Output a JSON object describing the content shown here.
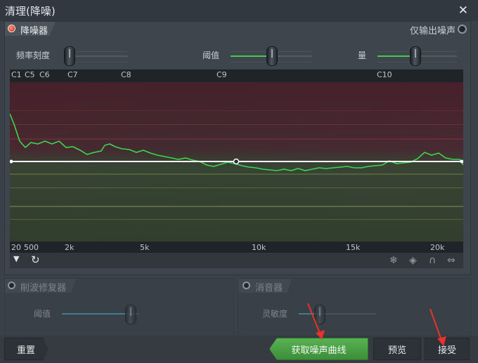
{
  "window": {
    "title": "清理(降噪)",
    "close_icon": "close-icon"
  },
  "denoiser": {
    "label": "降噪器",
    "enabled": true,
    "output_noise_only_label": "仅输出噪声",
    "output_noise_only": false,
    "controls": [
      {
        "label": "频率刻度",
        "level": 0.0
      },
      {
        "label": "阈值",
        "level": 0.5
      },
      {
        "label": "量",
        "level": 0.5
      }
    ]
  },
  "ruler": {
    "notes": [
      "C1",
      "C5",
      "C6",
      "C7",
      "C8",
      "C9",
      "C10"
    ]
  },
  "freq_axis": {
    "labels": [
      "20",
      "500",
      "2k",
      "5k",
      "10k",
      "15k",
      "20k"
    ]
  },
  "toolbar": {
    "left_icons": [
      "dropdown-arrow-icon",
      "reset-icon"
    ],
    "right_icons": [
      "snowflake-icon",
      "tag-icon",
      "magnet-icon",
      "arrows-icon"
    ]
  },
  "declipper": {
    "label": "削波修复器",
    "enabled": false,
    "threshold_label": "阈值"
  },
  "desser": {
    "label": "消音器",
    "enabled": false,
    "sensitivity_label": "灵敏度"
  },
  "buttons": {
    "reset": "重置",
    "get_noise_curve": "获取噪声曲线",
    "preview": "预览",
    "accept": "接受"
  },
  "colors": {
    "accent_green": "#3fcd4f",
    "led_on": "#e24a2e",
    "annotation_red": "#e8322a",
    "curve_white": "#ffffff"
  }
}
